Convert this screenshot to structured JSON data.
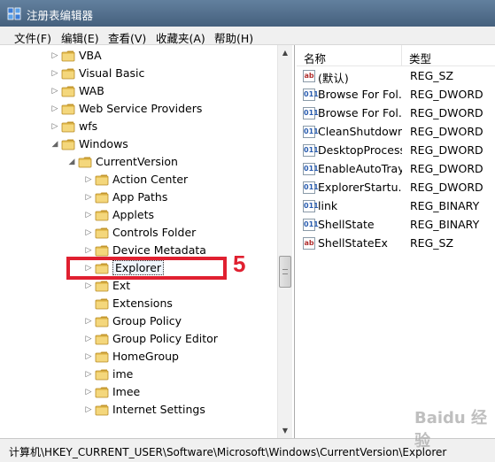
{
  "window": {
    "title": "注册表编辑器"
  },
  "menu": [
    "文件(F)",
    "编辑(E)",
    "查看(V)",
    "收藏夹(A)",
    "帮助(H)"
  ],
  "tree": [
    {
      "label": "VBA",
      "level": 2,
      "expander": "collapsed"
    },
    {
      "label": "Visual Basic",
      "level": 2,
      "expander": "collapsed"
    },
    {
      "label": "WAB",
      "level": 2,
      "expander": "collapsed"
    },
    {
      "label": "Web Service Providers",
      "level": 2,
      "expander": "collapsed"
    },
    {
      "label": "wfs",
      "level": 2,
      "expander": "collapsed"
    },
    {
      "label": "Windows",
      "level": 2,
      "expander": "expanded"
    },
    {
      "label": "CurrentVersion",
      "level": 3,
      "expander": "expanded"
    },
    {
      "label": "Action Center",
      "level": 4,
      "expander": "collapsed"
    },
    {
      "label": "App Paths",
      "level": 4,
      "expander": "collapsed"
    },
    {
      "label": "Applets",
      "level": 4,
      "expander": "collapsed"
    },
    {
      "label": "Controls Folder",
      "level": 4,
      "expander": "collapsed"
    },
    {
      "label": "Device Metadata",
      "level": 4,
      "expander": "collapsed"
    },
    {
      "label": "Explorer",
      "level": 4,
      "expander": "collapsed",
      "selected": true
    },
    {
      "label": "Ext",
      "level": 4,
      "expander": "collapsed"
    },
    {
      "label": "Extensions",
      "level": 4,
      "expander": "none"
    },
    {
      "label": "Group Policy",
      "level": 4,
      "expander": "collapsed"
    },
    {
      "label": "Group Policy Editor",
      "level": 4,
      "expander": "collapsed"
    },
    {
      "label": "HomeGroup",
      "level": 4,
      "expander": "collapsed"
    },
    {
      "label": "ime",
      "level": 4,
      "expander": "collapsed"
    },
    {
      "label": "Imee",
      "level": 4,
      "expander": "collapsed"
    },
    {
      "label": "Internet Settings",
      "level": 4,
      "expander": "collapsed"
    }
  ],
  "list": {
    "columns": [
      "名称",
      "类型"
    ],
    "rows": [
      {
        "name": "(默认)",
        "type": "REG_SZ",
        "icon": "string-value-icon"
      },
      {
        "name": "Browse For Fol...",
        "type": "REG_DWORD",
        "icon": "binary-value-icon"
      },
      {
        "name": "Browse For Fol...",
        "type": "REG_DWORD",
        "icon": "binary-value-icon"
      },
      {
        "name": "CleanShutdown",
        "type": "REG_DWORD",
        "icon": "binary-value-icon"
      },
      {
        "name": "DesktopProcess",
        "type": "REG_DWORD",
        "icon": "binary-value-icon"
      },
      {
        "name": "EnableAutoTray",
        "type": "REG_DWORD",
        "icon": "binary-value-icon"
      },
      {
        "name": "ExplorerStartu...",
        "type": "REG_DWORD",
        "icon": "binary-value-icon"
      },
      {
        "name": "link",
        "type": "REG_BINARY",
        "icon": "binary-value-icon"
      },
      {
        "name": "ShellState",
        "type": "REG_BINARY",
        "icon": "binary-value-icon"
      },
      {
        "name": "ShellStateEx",
        "type": "REG_SZ",
        "icon": "string-value-icon"
      }
    ]
  },
  "annotation": {
    "number": "5",
    "color": "#e02030"
  },
  "statusbar": {
    "path": "计算机\\HKEY_CURRENT_USER\\Software\\Microsoft\\Windows\\CurrentVersion\\Explorer"
  },
  "watermark": "Baidu 经验",
  "colors": {
    "titlebar": "#4f6d8c",
    "folder": "#e8c257",
    "annotation": "#e02030"
  }
}
